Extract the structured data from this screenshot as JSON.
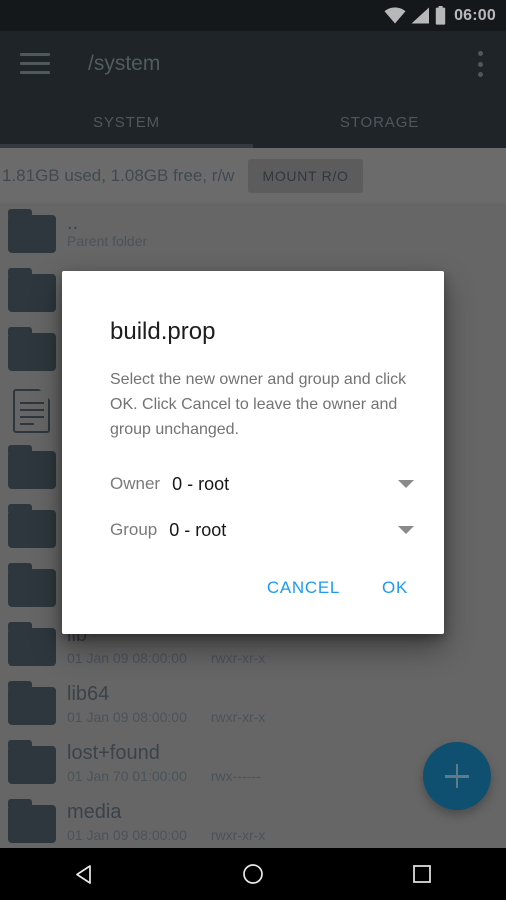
{
  "status_bar": {
    "time": "06:00",
    "icons": [
      "wifi-icon",
      "cell-signal-icon",
      "battery-icon"
    ]
  },
  "toolbar": {
    "menu_icon": "hamburger-menu-icon",
    "title": "/system",
    "overflow_icon": "overflow-menu-icon",
    "tabs": [
      {
        "label": "SYSTEM",
        "active": true
      },
      {
        "label": "STORAGE",
        "active": false
      }
    ]
  },
  "mount_bar": {
    "info": "1.81GB used, 1.08GB free, r/w",
    "button_label": "MOUNT R/O"
  },
  "file_list": [
    {
      "icon": "folder-icon",
      "name": "..",
      "sub": "Parent folder",
      "perm": ""
    },
    {
      "icon": "folder-icon",
      "name": "",
      "sub": "",
      "perm": ""
    },
    {
      "icon": "folder-icon",
      "name": "",
      "sub": "",
      "perm": ""
    },
    {
      "icon": "file-icon",
      "name": "",
      "sub": "",
      "perm": ""
    },
    {
      "icon": "folder-icon",
      "name": "",
      "sub": "",
      "perm": ""
    },
    {
      "icon": "folder-icon",
      "name": "",
      "sub": "",
      "perm": ""
    },
    {
      "icon": "folder-icon",
      "name": "",
      "sub": "",
      "perm": ""
    },
    {
      "icon": "folder-icon",
      "name": "lib",
      "sub": "01 Jan 09 08:00:00",
      "perm": "rwxr-xr-x"
    },
    {
      "icon": "folder-icon",
      "name": "lib64",
      "sub": "01 Jan 09 08:00:00",
      "perm": "rwxr-xr-x"
    },
    {
      "icon": "folder-icon",
      "name": "lost+found",
      "sub": "01 Jan 70 01:00:00",
      "perm": "rwx------"
    },
    {
      "icon": "folder-icon",
      "name": "media",
      "sub": "01 Jan 09 08:00:00",
      "perm": "rwxr-xr-x"
    }
  ],
  "fab": {
    "icon": "plus-icon",
    "color": "#0f4f70"
  },
  "dialog": {
    "title": "build.prop",
    "message": "Select the new owner and group and click OK. Click Cancel to leave the owner and group unchanged.",
    "owner": {
      "label": "Owner",
      "value": "0 - root",
      "caret": "chevron-down-icon"
    },
    "group": {
      "label": "Group",
      "value": "0 - root",
      "caret": "chevron-down-icon"
    },
    "cancel_label": "CANCEL",
    "ok_label": "OK",
    "accent_color": "#1e9bf0"
  },
  "navbar": {
    "back_icon": "back-triangle-icon",
    "home_icon": "home-circle-icon",
    "recents_icon": "recents-square-icon"
  }
}
